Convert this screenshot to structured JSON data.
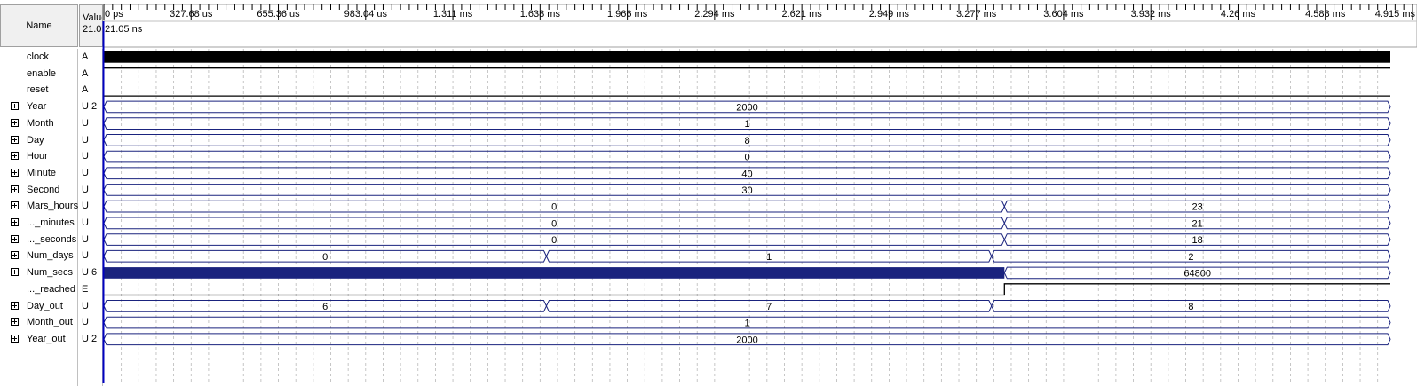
{
  "header": {
    "name_label": "Name",
    "value_label": "Value",
    "value_sub": "21.0"
  },
  "timeline": {
    "ticks": [
      "0 ps",
      "327.68 us",
      "655.36 us",
      "983.04 us",
      "1.311 ms",
      "1.638 ms",
      "1.966 ms",
      "2.294 ms",
      "2.621 ms",
      "2.949 ms",
      "3.277 ms",
      "3.604 ms",
      "3.932 ms",
      "4.26 ms",
      "4.588 ms",
      "4.915 ms"
    ],
    "cursor_label": "21.05 ns",
    "end_time_ms": 5.0
  },
  "colors": {
    "bus": "#1a237e",
    "bit": "#000000",
    "grid": "#b8b8b8",
    "cursor": "#0000c0"
  },
  "signals": [
    {
      "name": "clock",
      "value": "A",
      "expand": false,
      "kind": "clock"
    },
    {
      "name": "enable",
      "value": "A",
      "expand": false,
      "kind": "bit",
      "level": 1
    },
    {
      "name": "reset",
      "value": "A",
      "expand": false,
      "kind": "bit",
      "level": 0
    },
    {
      "name": "Year",
      "value": "U 2",
      "expand": true,
      "kind": "bus",
      "segments": [
        {
          "t0": 0,
          "t1": 5.0,
          "label": "2000"
        }
      ]
    },
    {
      "name": "Month",
      "value": "U",
      "expand": true,
      "kind": "bus",
      "segments": [
        {
          "t0": 0,
          "t1": 5.0,
          "label": "1"
        }
      ]
    },
    {
      "name": "Day",
      "value": "U",
      "expand": true,
      "kind": "bus",
      "segments": [
        {
          "t0": 0,
          "t1": 5.0,
          "label": "8"
        }
      ]
    },
    {
      "name": "Hour",
      "value": "U",
      "expand": true,
      "kind": "bus",
      "segments": [
        {
          "t0": 0,
          "t1": 5.0,
          "label": "0"
        }
      ]
    },
    {
      "name": "Minute",
      "value": "U",
      "expand": true,
      "kind": "bus",
      "segments": [
        {
          "t0": 0,
          "t1": 5.0,
          "label": "40"
        }
      ]
    },
    {
      "name": "Second",
      "value": "U",
      "expand": true,
      "kind": "bus",
      "segments": [
        {
          "t0": 0,
          "t1": 5.0,
          "label": "30"
        }
      ]
    },
    {
      "name": "Mars_hours",
      "value": "U",
      "expand": true,
      "kind": "bus",
      "segments": [
        {
          "t0": 0,
          "t1": 3.5,
          "label": "0"
        },
        {
          "t0": 3.5,
          "t1": 5.0,
          "label": "23"
        }
      ]
    },
    {
      "name": "..._minutes",
      "value": "U",
      "expand": true,
      "kind": "bus",
      "segments": [
        {
          "t0": 0,
          "t1": 3.5,
          "label": "0"
        },
        {
          "t0": 3.5,
          "t1": 5.0,
          "label": "21"
        }
      ]
    },
    {
      "name": "..._seconds",
      "value": "U",
      "expand": true,
      "kind": "bus",
      "segments": [
        {
          "t0": 0,
          "t1": 3.5,
          "label": "0"
        },
        {
          "t0": 3.5,
          "t1": 5.0,
          "label": "18"
        }
      ]
    },
    {
      "name": "Num_days",
      "value": "U",
      "expand": true,
      "kind": "bus",
      "segments": [
        {
          "t0": 0,
          "t1": 1.72,
          "label": "0"
        },
        {
          "t0": 1.72,
          "t1": 3.45,
          "label": "1"
        },
        {
          "t0": 3.45,
          "t1": 5.0,
          "label": "2"
        }
      ]
    },
    {
      "name": "Num_secs",
      "value": "U 6",
      "expand": true,
      "kind": "bus",
      "segments": [
        {
          "t0": 0,
          "t1": 3.5,
          "label": "",
          "dense": true
        },
        {
          "t0": 3.5,
          "t1": 5.0,
          "label": "64800"
        }
      ]
    },
    {
      "name": "..._reached",
      "value": "E",
      "expand": false,
      "kind": "bit",
      "level": 0,
      "rise_at": 3.5
    },
    {
      "name": "Day_out",
      "value": "U",
      "expand": true,
      "kind": "bus",
      "segments": [
        {
          "t0": 0,
          "t1": 1.72,
          "label": "6"
        },
        {
          "t0": 1.72,
          "t1": 3.45,
          "label": "7"
        },
        {
          "t0": 3.45,
          "t1": 5.0,
          "label": "8"
        }
      ]
    },
    {
      "name": "Month_out",
      "value": "U",
      "expand": true,
      "kind": "bus",
      "segments": [
        {
          "t0": 0,
          "t1": 5.0,
          "label": "1"
        }
      ]
    },
    {
      "name": "Year_out",
      "value": "U 2",
      "expand": true,
      "kind": "bus",
      "segments": [
        {
          "t0": 0,
          "t1": 5.0,
          "label": "2000"
        }
      ]
    }
  ]
}
